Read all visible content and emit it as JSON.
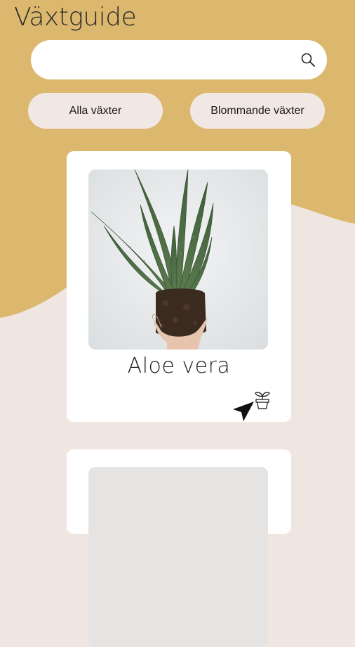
{
  "header": {
    "title": "Växtguide"
  },
  "search": {
    "value": "",
    "placeholder": "",
    "icon": "search-icon"
  },
  "filters": [
    {
      "label": "Alla växter"
    },
    {
      "label": "Blommande växter"
    }
  ],
  "plants": [
    {
      "name": "Aloe vera",
      "image": "aloe-vera-photo",
      "action_icon": "plant-pot-icon"
    },
    {
      "name": "",
      "image": "plant-photo"
    }
  ],
  "colors": {
    "header_background": "#dcb86f",
    "page_background": "#efe6e2",
    "card_background": "#ffffff",
    "button_background": "#f1e8e4"
  }
}
